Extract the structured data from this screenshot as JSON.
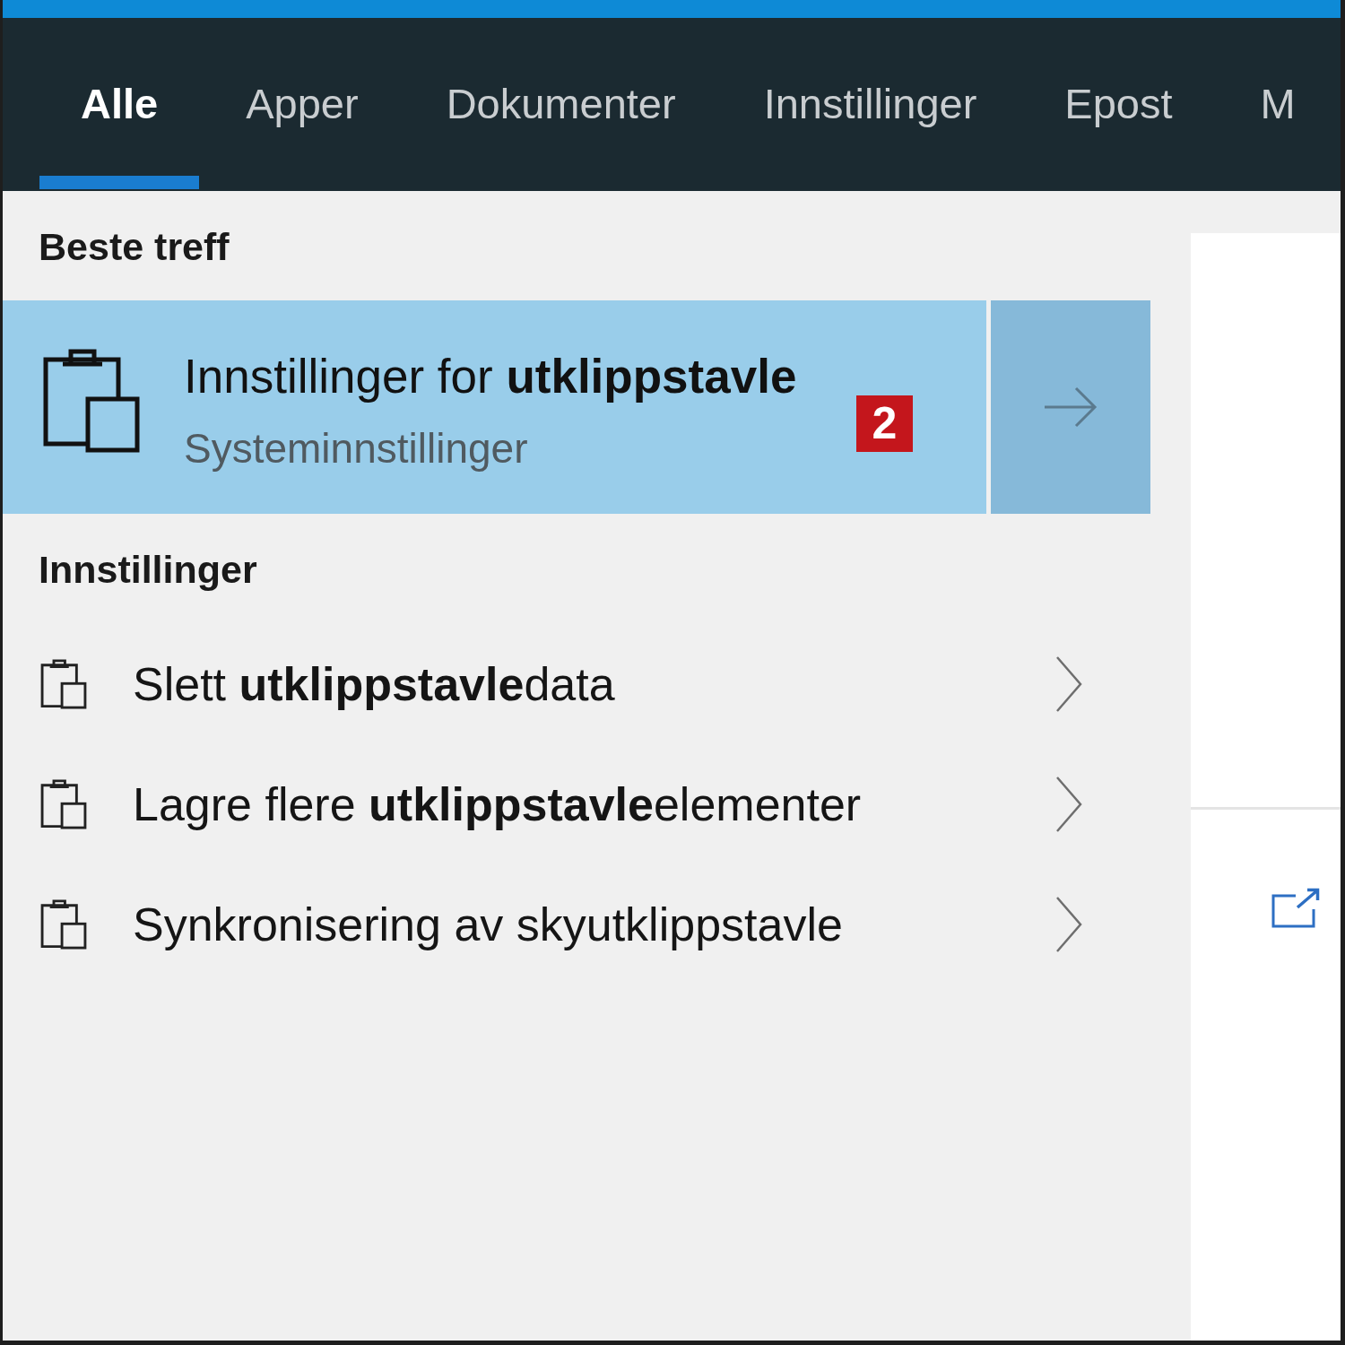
{
  "tabs": [
    {
      "label": "Alle",
      "selected": true
    },
    {
      "label": "Apper",
      "selected": false
    },
    {
      "label": "Dokumenter",
      "selected": false
    },
    {
      "label": "Innstillinger",
      "selected": false
    },
    {
      "label": "Epost",
      "selected": false
    },
    {
      "label": "M",
      "selected": false
    }
  ],
  "best_match": {
    "heading": "Beste treff",
    "title": "Innstillinger for **utklippstavle**",
    "subtitle": "Systeminnstillinger",
    "annotation_badge": "2"
  },
  "settings": {
    "heading": "Innstillinger",
    "items": [
      {
        "label": "Slett **utklippstavle**data"
      },
      {
        "label": "Lagre flere **utklippstavle**elementer"
      },
      {
        "label": "Synkronisering av skyutklippstavle"
      }
    ]
  }
}
